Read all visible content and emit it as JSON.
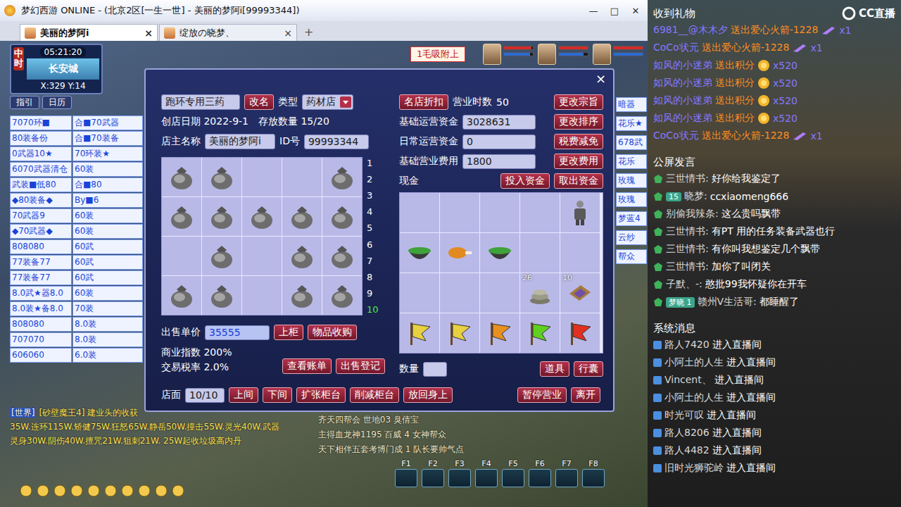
{
  "window": {
    "title": "梦幻西游 ONLINE - (北京2区[一生一世] - 美丽的梦阿i[99993344])",
    "controls": [
      "—",
      "□",
      "✕"
    ]
  },
  "tabs": [
    {
      "label": "美丽的梦阿i",
      "selected": true,
      "close": "×"
    },
    {
      "label": "绽放の晓梦、",
      "selected": false,
      "close": "×"
    }
  ],
  "new_tab": "+",
  "minimap": {
    "time": "05:21:20",
    "location": "长安城",
    "coords": "X:329 Y:14",
    "period": "中时",
    "buttons": [
      "指引",
      "日历"
    ]
  },
  "top_banner": "1毛吸附上",
  "party": [
    {
      "hp": 0.95,
      "mp": 0.9
    },
    {
      "hp": 1,
      "mp": 0.85
    },
    {
      "hp": 1,
      "mp": 1
    }
  ],
  "stalls_left": [
    "7070环■",
    "合■70武器",
    "80装备份",
    "合■70装备",
    "0武器10★",
    "70环装★",
    "6070武器清仓",
    "60装",
    "武装■低80",
    "合■80",
    "◆80装备◆",
    "By■6",
    "70武器9",
    "60装",
    "◆70武器◆",
    "60装",
    "808080",
    "60武",
    "77装备77",
    "60武",
    "77装备77",
    "60武",
    "8.0武★器8.0",
    "60装",
    "8.0装★备8.0",
    "70装",
    "808080",
    "8.0装",
    "707070",
    "8.0装",
    "606060",
    "6.0装"
  ],
  "stalls_right": [
    "暗器",
    "花乐★",
    "678武",
    "花乐",
    "玫瑰",
    "玫瑰",
    "梦蓝4",
    "云纱",
    "帮众"
  ],
  "shop": {
    "close": "×",
    "name": "跑环专用三药",
    "rename": "改名",
    "type_label": "类型",
    "type": "药材店",
    "discount": "名店折扣",
    "hours_label": "营业时数",
    "hours": "50",
    "purpose": "更改宗旨",
    "created_label": "创店日期",
    "created": "2022-9-1",
    "storage_label": "存放数量",
    "storage": "15/20",
    "owner_label": "店主名称",
    "owner": "美丽的梦阿i",
    "id_label": "ID号",
    "id": "99993344",
    "funds": [
      {
        "label": "基础运营资金",
        "value": "3028631",
        "button": "更改排序"
      },
      {
        "label": "日常运营资金",
        "value": "0",
        "button": "税费减免"
      },
      {
        "label": "基础营业费用",
        "value": "1800",
        "button": "更改费用"
      }
    ],
    "cash_label": "现金",
    "cash_buttons": [
      "投入资金",
      "取出资金"
    ],
    "counter": [
      {
        "kind": "bag"
      },
      {
        "kind": "bag"
      },
      {
        "kind": "empty"
      },
      {
        "kind": "empty"
      },
      {
        "kind": "bag"
      },
      {
        "kind": "bag"
      },
      {
        "kind": "bag"
      },
      {
        "kind": "bag"
      },
      {
        "kind": "bag"
      },
      {
        "kind": "bag"
      },
      {
        "kind": "empty"
      },
      {
        "kind": "bag"
      },
      {
        "kind": "empty"
      },
      {
        "kind": "bag"
      },
      {
        "kind": "bag"
      },
      {
        "kind": "bag"
      },
      {
        "kind": "bag"
      },
      {
        "kind": "empty"
      },
      {
        "kind": "bag"
      },
      {
        "kind": "bag"
      }
    ],
    "pages": [
      {
        "label": "1",
        "selected": false
      },
      {
        "label": "2",
        "selected": false
      },
      {
        "label": "3",
        "selected": false
      },
      {
        "label": "4",
        "selected": false
      },
      {
        "label": "5",
        "selected": false
      },
      {
        "label": "6",
        "selected": false
      },
      {
        "label": "7",
        "selected": false
      },
      {
        "label": "8",
        "selected": false
      },
      {
        "label": "9",
        "selected": false
      },
      {
        "label": "10",
        "selected": true
      }
    ],
    "price_label": "出售单价",
    "price": "35555",
    "shelve": "上柜",
    "buy": "物品收购",
    "stats": [
      {
        "label": "商业指数",
        "value": "200%"
      },
      {
        "label": "交易税率",
        "value": "2.0%"
      }
    ],
    "ledger_buttons": [
      "查看账单",
      "出售登记"
    ],
    "inventory": [
      {
        "kind": "empty"
      },
      {
        "kind": "empty"
      },
      {
        "kind": "empty"
      },
      {
        "kind": "empty"
      },
      {
        "kind": "armor"
      },
      {
        "kind": "bowl"
      },
      {
        "kind": "drumstick"
      },
      {
        "kind": "bowl"
      },
      {
        "kind": "empty"
      },
      {
        "kind": "empty"
      },
      {
        "kind": "empty"
      },
      {
        "kind": "empty"
      },
      {
        "kind": "empty"
      },
      {
        "kind": "stack",
        "count": "26"
      },
      {
        "kind": "book",
        "count": "10"
      },
      {
        "kind": "flag",
        "color": "#e8d040"
      },
      {
        "kind": "flag",
        "color": "#e8d040"
      },
      {
        "kind": "flag",
        "color": "#e89020"
      },
      {
        "kind": "flag",
        "color": "#60d020"
      },
      {
        "kind": "flag",
        "color": "#e03020"
      }
    ],
    "qty_label": "数量",
    "qty": "",
    "bag_tabs": [
      {
        "label": "道具",
        "selected": false
      },
      {
        "label": "行囊",
        "selected": false
      }
    ],
    "floor_label": "店面",
    "floor": "10/10",
    "floor_buttons": [
      "上间",
      "下间",
      "扩张柜台",
      "削减柜台",
      "放回身上"
    ],
    "end_buttons": [
      "暂停营业",
      "离开"
    ]
  },
  "chat_left": [
    {
      "channel": "[世界]",
      "text": "[砂壁魔王4] 建业头的收获"
    },
    {
      "channel": "",
      "text": "35W.连环115W.矫健75W.狂怒65W.静岳50W.撞击55W.灵光40W.武器"
    },
    {
      "channel": "",
      "text": "灵身30W.阴伤40W.擅咒21W.狙刺21W.   25W起收垃圾高内丹"
    }
  ],
  "chat_right": [
    "齐天四帮会  世地03  臭倩宝",
    "主得血龙神1195  百威 4  女神帮众",
    "天下相伴五套考博门成 1  队长要帅气点"
  ],
  "hotkeys": [
    "F1",
    "F2",
    "F3",
    "F4",
    "F5",
    "F6",
    "F7",
    "F8"
  ],
  "side": {
    "gift_header": "收到礼物",
    "logo": "CC直播",
    "gifts": [
      {
        "user": "6981__@木木夕",
        "action": "送出爱心火箭-1228",
        "kind": "rocket",
        "count": "x1"
      },
      {
        "user": "CoCo状元",
        "action": "送出爱心火箭-1228",
        "kind": "rocket",
        "count": "x1"
      },
      {
        "user": "如风的小迷弟",
        "action": "送出积分",
        "kind": "points",
        "count": "x520"
      },
      {
        "user": "如风的小迷弟",
        "action": "送出积分",
        "kind": "points",
        "count": "x520"
      },
      {
        "user": "如风的小迷弟",
        "action": "送出积分",
        "kind": "points",
        "count": "x520"
      },
      {
        "user": "如风的小迷弟",
        "action": "送出积分",
        "kind": "points",
        "count": "x520"
      },
      {
        "user": "CoCo状元",
        "action": "送出爱心火箭-1228",
        "kind": "rocket",
        "count": "x1"
      }
    ],
    "chat_header": "公屏发言",
    "messages": [
      {
        "badge": "",
        "user": "三世情书:",
        "text": "好你给我鉴定了"
      },
      {
        "badge": "15",
        "user": "晓梦:",
        "text": "ccxiaomeng666"
      },
      {
        "badge": "",
        "user": "别偷我辣条:",
        "text": "这么贵吗飘带"
      },
      {
        "badge": "",
        "user": "三世情书:",
        "text": "有PT 用的任务装备武器也行"
      },
      {
        "badge": "",
        "user": "三世情书:",
        "text": "有你叫我想鉴定几个飘带"
      },
      {
        "badge": "",
        "user": "三世情书:",
        "text": "加你了叫闭关"
      },
      {
        "badge": "",
        "user": "子默、-:",
        "text": "憨批99我怀疑你在开车"
      },
      {
        "badge": "梦晓 1",
        "user": "赣州V生活哥:",
        "text": "都睡醒了"
      }
    ],
    "system_header": "系统消息",
    "system": [
      {
        "user": "路人7420",
        "text": "进入直播间"
      },
      {
        "user": "小阿土的人生",
        "text": "进入直播间"
      },
      {
        "user": "Vincent、",
        "text": "进入直播间"
      },
      {
        "user": "小阿土的人生",
        "text": "进入直播间"
      },
      {
        "user": "时光可叹",
        "text": "进入直播间"
      },
      {
        "user": "路人8206",
        "text": "进入直播间"
      },
      {
        "user": "路人4482",
        "text": "进入直播间"
      },
      {
        "user": "旧时光狮驼岭",
        "text": "进入直播间"
      }
    ]
  }
}
